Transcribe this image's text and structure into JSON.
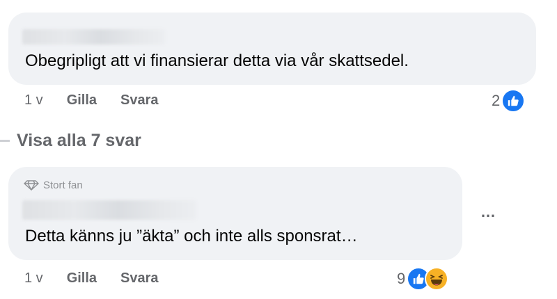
{
  "comments": [
    {
      "text": "Obegripligt att vi finansierar detta via vår skattsedel.",
      "time": "1 v",
      "like_label": "Gilla",
      "reply_label": "Svara",
      "reaction_count": "2",
      "reactions": [
        "like-icon"
      ]
    },
    {
      "badge": "Stort fan",
      "text": "Detta känns ju ”äkta” och inte alls sponsrat…",
      "time": "1 v",
      "like_label": "Gilla",
      "reply_label": "Svara",
      "reaction_count": "9",
      "reactions": [
        "like-icon",
        "haha-icon"
      ],
      "more_label": "…"
    }
  ],
  "view_replies": "Visa alla 7 svar",
  "colors": {
    "bubble": "#f0f2f5",
    "meta": "#65676b",
    "like": "#1877f2",
    "haha": "#f7b125"
  }
}
